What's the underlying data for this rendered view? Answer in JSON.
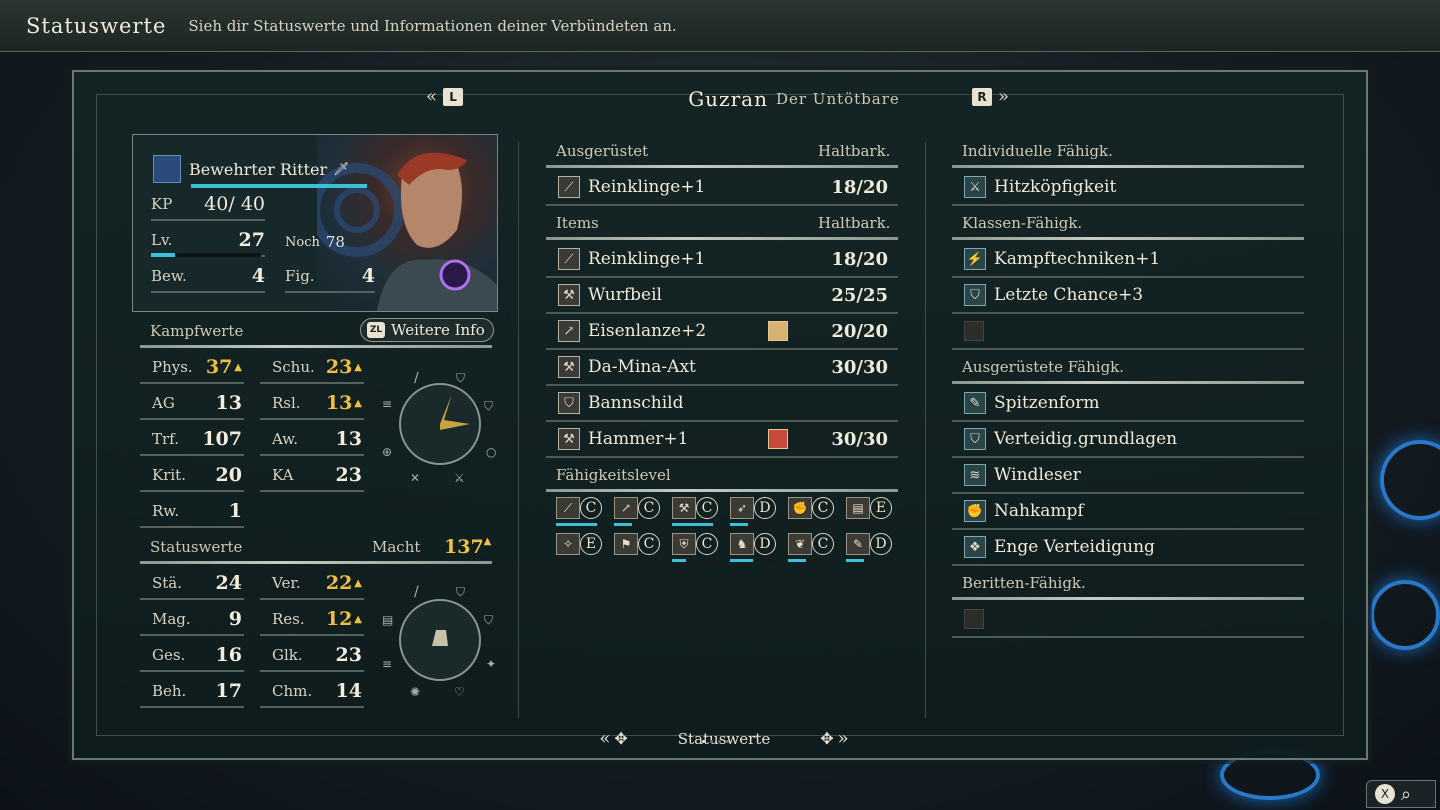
{
  "topbar": {
    "title": "Statuswerte",
    "subtitle": "Sieh dir Statuswerte und Informationen deiner Verbündeten an."
  },
  "unit": {
    "name": "Guzran",
    "epithet": "Der Untötbare",
    "class": "Bewehrter Ritter",
    "hp_label": "KP",
    "hp_current": "40",
    "hp_max": "40",
    "hp_fraction": 1.0,
    "level_label": "Lv.",
    "level": "27",
    "exp_label": "Noch",
    "exp_remaining": "78",
    "exp_fraction": 0.22,
    "move_label": "Bew.",
    "move": "4",
    "fig_label": "Fig.",
    "fig": "4"
  },
  "nav": {
    "prev_key": "L",
    "next_key": "R"
  },
  "combat": {
    "title": "Kampfwerte",
    "more_info": "Weitere Info",
    "more_info_key": "ZL",
    "stats_left": [
      {
        "label": "Phys.",
        "value": "37",
        "up": true
      },
      {
        "label": "AG",
        "value": "13",
        "up": false
      },
      {
        "label": "Trf.",
        "value": "107",
        "up": false
      },
      {
        "label": "Krit.",
        "value": "20",
        "up": false
      },
      {
        "label": "Rw.",
        "value": "1",
        "up": false
      }
    ],
    "stats_right": [
      {
        "label": "Schu.",
        "value": "23",
        "up": true
      },
      {
        "label": "Rsl.",
        "value": "13",
        "up": true
      },
      {
        "label": "Aw.",
        "value": "13",
        "up": false
      },
      {
        "label": "KA",
        "value": "23",
        "up": false
      }
    ]
  },
  "status": {
    "title": "Statuswerte",
    "power_label": "Macht",
    "power": "137",
    "stats_left": [
      {
        "label": "Stä.",
        "value": "24",
        "up": false
      },
      {
        "label": "Mag.",
        "value": "9",
        "up": false
      },
      {
        "label": "Ges.",
        "value": "16",
        "up": false
      },
      {
        "label": "Beh.",
        "value": "17",
        "up": false
      }
    ],
    "stats_right": [
      {
        "label": "Ver.",
        "value": "22",
        "up": true
      },
      {
        "label": "Res.",
        "value": "12",
        "up": true
      },
      {
        "label": "Glk.",
        "value": "23",
        "up": false
      },
      {
        "label": "Chm.",
        "value": "14",
        "up": false
      }
    ]
  },
  "equipped": {
    "title": "Ausgerüstet",
    "dur_header": "Haltbark.",
    "items": [
      {
        "name": "Reinklinge+1",
        "dur": "18/20",
        "icon": "sword-icon"
      }
    ]
  },
  "items": {
    "title": "Items",
    "dur_header": "Haltbark.",
    "list": [
      {
        "name": "Reinklinge+1",
        "dur": "18/20",
        "icon": "sword-icon",
        "badge": ""
      },
      {
        "name": "Wurfbeil",
        "dur": "25/25",
        "icon": "axe-icon",
        "badge": ""
      },
      {
        "name": "Eisenlanze+2",
        "dur": "20/20",
        "icon": "lance-icon",
        "badge": "scroll"
      },
      {
        "name": "Da-Mina-Axt",
        "dur": "30/30",
        "icon": "axe-icon",
        "badge": ""
      },
      {
        "name": "Bannschild",
        "dur": "",
        "icon": "shield-icon",
        "badge": ""
      },
      {
        "name": "Hammer+1",
        "dur": "30/30",
        "icon": "axe-icon",
        "badge": "helmet"
      }
    ]
  },
  "weapon_levels": {
    "title": "Fähigkeitslevel",
    "levels": [
      {
        "icon": "sword-icon",
        "grade": "C",
        "progress": 0.9
      },
      {
        "icon": "lance-icon",
        "grade": "C",
        "progress": 0.4
      },
      {
        "icon": "axe-icon",
        "grade": "C",
        "progress": 0.9
      },
      {
        "icon": "bow-icon",
        "grade": "D",
        "progress": 0.4
      },
      {
        "icon": "gauntlet-icon",
        "grade": "C",
        "progress": 0.0
      },
      {
        "icon": "reason-icon",
        "grade": "E",
        "progress": 0.0
      },
      {
        "icon": "faith-icon",
        "grade": "E",
        "progress": 0.0
      },
      {
        "icon": "authority-icon",
        "grade": "C",
        "progress": 0.0
      },
      {
        "icon": "heavy-armor-icon",
        "grade": "C",
        "progress": 0.3
      },
      {
        "icon": "riding-icon",
        "grade": "D",
        "progress": 0.5
      },
      {
        "icon": "flying-icon",
        "grade": "C",
        "progress": 0.4
      },
      {
        "icon": "feather-icon",
        "grade": "D",
        "progress": 0.4
      }
    ]
  },
  "skills": {
    "personal_title": "Individuelle Fähigk.",
    "personal": [
      {
        "name": "Hitzköpfigkeit",
        "icon": "crossed-swords-icon"
      }
    ],
    "class_title": "Klassen-Fähigk.",
    "class": [
      {
        "name": "Kampftechniken+1",
        "icon": "slash-icon"
      },
      {
        "name": "Letzte Chance+3",
        "icon": "shield-icon"
      }
    ],
    "equipped_title": "Ausgerüstete Fähigk.",
    "equipped": [
      {
        "name": "Spitzenform",
        "icon": "feather-icon"
      },
      {
        "name": "Verteidig.grundlagen",
        "icon": "shield-icon"
      },
      {
        "name": "Windleser",
        "icon": "wind-icon"
      },
      {
        "name": "Nahkampf",
        "icon": "fist-icon"
      },
      {
        "name": "Enge Verteidigung",
        "icon": "guard-icon"
      }
    ],
    "mounted_title": "Beritten-Fähigk."
  },
  "footer": {
    "label": "Statuswerte"
  },
  "corner": {
    "key": "X"
  },
  "colors": {
    "accent_gold": "#f0c040",
    "accent_cyan": "#3cc0d8"
  }
}
